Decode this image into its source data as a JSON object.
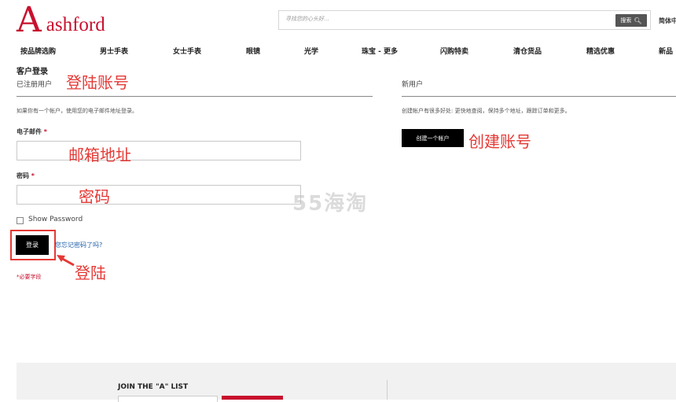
{
  "header": {
    "logo_mark": "A",
    "logo_text": "ashford",
    "search_placeholder": "寻找您的心头好...",
    "search_button": "搜索",
    "search_icon": "search-icon",
    "lang": "简体中"
  },
  "nav": [
    {
      "label": "按品牌选购"
    },
    {
      "label": "男士手表"
    },
    {
      "label": "女士手表"
    },
    {
      "label": "眼镜"
    },
    {
      "label": "光学"
    },
    {
      "label": "珠宝 - 更多"
    },
    {
      "label": "闪购特卖"
    },
    {
      "label": "清仓货品"
    },
    {
      "label": "精选优惠"
    },
    {
      "label": "新品"
    }
  ],
  "login": {
    "title": "客户登录",
    "subtitle": "已注册用户",
    "intro": "如果你有一个帐户，使用您的电子邮件地址登录。",
    "email_label": "电子邮件",
    "password_label": "密码",
    "required_star": "*",
    "show_password": "Show Password",
    "submit": "登录",
    "forgot": "您忘记密码了吗?",
    "required_note": "*必要字段"
  },
  "register": {
    "title": "新用户",
    "benefits": "创建帐户有很多好处: 更快地查阅，保持多个地址，跟踪订单和更多。",
    "create_button": "创建一个帐户"
  },
  "annotations": {
    "login_account": "登陆账号",
    "email_address": "邮箱地址",
    "password": "密码",
    "create_account": "创建账号",
    "submit": "登陆",
    "color": "#e53935"
  },
  "watermark": "55海淘",
  "footer": {
    "join_title": "JOIN THE \"A\" LIST"
  },
  "colors": {
    "brand": "#c8102e",
    "button": "#000000",
    "link": "#1f5fa8"
  }
}
